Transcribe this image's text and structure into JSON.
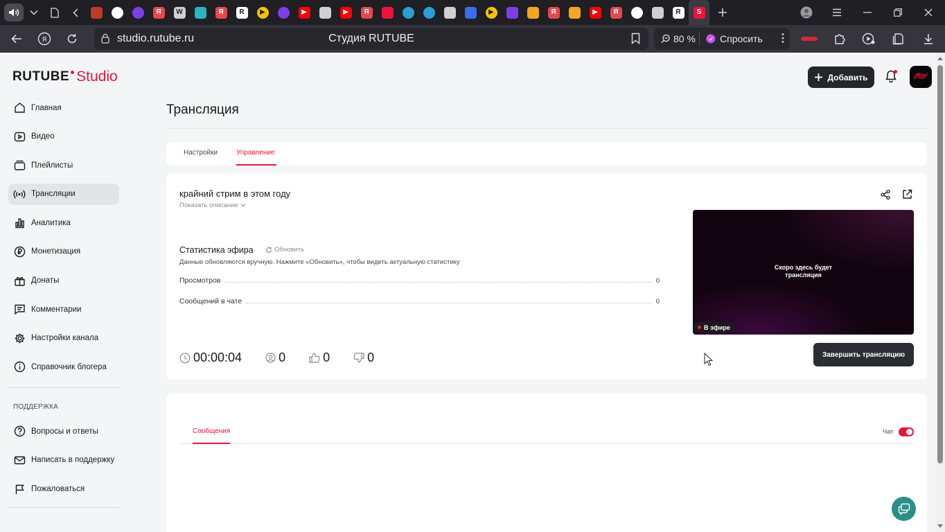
{
  "browser": {
    "url_host": "studio.rutube.ru",
    "page_title": "Студия RUTUBE",
    "zoom": "80 %",
    "ask_label": "Спросить",
    "tabs": [
      {
        "icon": "file-icon",
        "color": "",
        "letter": ""
      },
      {
        "icon": "back-arrow-icon",
        "color": "",
        "letter": ""
      },
      {
        "icon": "box-icon",
        "color": "#c0392b",
        "letter": ""
      },
      {
        "icon": "refresh-circle-icon",
        "color": "#ffffff",
        "letter": ""
      },
      {
        "icon": "alice-icon",
        "color": "#7b3fe4",
        "letter": ""
      },
      {
        "icon": "yandex-icon",
        "color": "#e5484d",
        "letter": "Я"
      },
      {
        "icon": "wordpress-icon",
        "color": "#d0d0d0",
        "letter": "W"
      },
      {
        "icon": "image-icon",
        "color": "#2bb3c0",
        "letter": ""
      },
      {
        "icon": "yandex-icon",
        "color": "#e5484d",
        "letter": "Я"
      },
      {
        "icon": "rutube-r-icon",
        "color": "#ffffff",
        "letter": "R"
      },
      {
        "icon": "play-icon",
        "color": "#f5c400",
        "letter": "▶"
      },
      {
        "icon": "alice-icon",
        "color": "#7b3fe4",
        "letter": ""
      },
      {
        "icon": "youtube-icon",
        "color": "#ff0000",
        "letter": "▶"
      },
      {
        "icon": "rocket-icon",
        "color": "#d0d0d0",
        "letter": ""
      },
      {
        "icon": "youtube-icon",
        "color": "#ff0000",
        "letter": "▶"
      },
      {
        "icon": "yandex-icon",
        "color": "#e5484d",
        "letter": "Я"
      },
      {
        "icon": "vk-icon",
        "color": "#ed143b",
        "letter": ""
      },
      {
        "icon": "telegram-icon",
        "color": "#2a9fd6",
        "letter": ""
      },
      {
        "icon": "telegram-icon",
        "color": "#2a9fd6",
        "letter": ""
      },
      {
        "icon": "check-icon",
        "color": "#d0d0d0",
        "letter": ""
      },
      {
        "icon": "image-icon",
        "color": "#3a6df0",
        "letter": ""
      },
      {
        "icon": "play-icon",
        "color": "#f5c400",
        "letter": "▶"
      },
      {
        "icon": "chart-icon",
        "color": "#7b3fe4",
        "letter": ""
      },
      {
        "icon": "crown-icon",
        "color": "#f5a623",
        "letter": ""
      },
      {
        "icon": "yandex-icon",
        "color": "#e5484d",
        "letter": "Я"
      },
      {
        "icon": "crown-icon",
        "color": "#f5a623",
        "letter": ""
      },
      {
        "icon": "youtube-icon",
        "color": "#ff0000",
        "letter": "▶"
      },
      {
        "icon": "yandex-icon",
        "color": "#e5484d",
        "letter": "Я"
      },
      {
        "icon": "github-icon",
        "color": "#ffffff",
        "letter": ""
      },
      {
        "icon": "rocket-icon",
        "color": "#d0d0d0",
        "letter": ""
      },
      {
        "icon": "rutube-r-icon",
        "color": "#ffffff",
        "letter": "R"
      },
      {
        "icon": "rutube-studio-icon",
        "color": "#ed143b",
        "letter": "S"
      }
    ]
  },
  "logo": {
    "brand": "RUTUBE",
    "product": "Studio"
  },
  "header": {
    "add_label": "Добавить"
  },
  "sidebar": {
    "items": [
      {
        "label": "Главная",
        "icon": "home-icon"
      },
      {
        "label": "Видео",
        "icon": "video-icon"
      },
      {
        "label": "Плейлисты",
        "icon": "playlist-icon"
      },
      {
        "label": "Трансляции",
        "icon": "broadcast-icon",
        "active": true
      },
      {
        "label": "Аналитика",
        "icon": "analytics-icon"
      },
      {
        "label": "Монетизация",
        "icon": "ruble-icon"
      },
      {
        "label": "Донаты",
        "icon": "gift-icon"
      },
      {
        "label": "Комментарии",
        "icon": "comment-icon"
      },
      {
        "label": "Настройки канала",
        "icon": "gear-icon"
      },
      {
        "label": "Справочник блогера",
        "icon": "info-icon"
      }
    ],
    "support_heading": "ПОДДЕРЖКА",
    "support_items": [
      {
        "label": "Вопросы и ответы",
        "icon": "question-icon"
      },
      {
        "label": "Написать в поддержку",
        "icon": "mail-icon"
      },
      {
        "label": "Пожаловаться",
        "icon": "flag-icon"
      }
    ]
  },
  "main": {
    "title": "Трансляция",
    "tabs": [
      {
        "label": "Настройки"
      },
      {
        "label": "Управление",
        "active": true
      }
    ],
    "stream": {
      "title": "крайний стрим в этом году",
      "show_description": "Показать описание"
    },
    "stats": {
      "title": "Статистика эфира",
      "refresh_label": "Обновить",
      "note": "Данные обновляются вручную. Нажмите «Обновить», чтобы видеть актуальную статистику",
      "rows": [
        {
          "label": "Просмотров",
          "value": "0"
        },
        {
          "label": "Сообщений в чате",
          "value": "0"
        }
      ]
    },
    "metrics": {
      "duration": "00:00:04",
      "viewers": "0",
      "likes": "0",
      "dislikes": "0"
    },
    "player": {
      "message_line1": "Скоро здесь будет",
      "message_line2": "трансляция",
      "live_label": "В эфире"
    },
    "end_button": "Завершить трансляцию"
  },
  "chat": {
    "tab_label": "Сообщения",
    "toggle_label": "Чат",
    "toggle_on": true
  },
  "colors": {
    "accent": "#ed143b",
    "dark_button": "#25262b",
    "support_fab": "#2b8f87"
  }
}
